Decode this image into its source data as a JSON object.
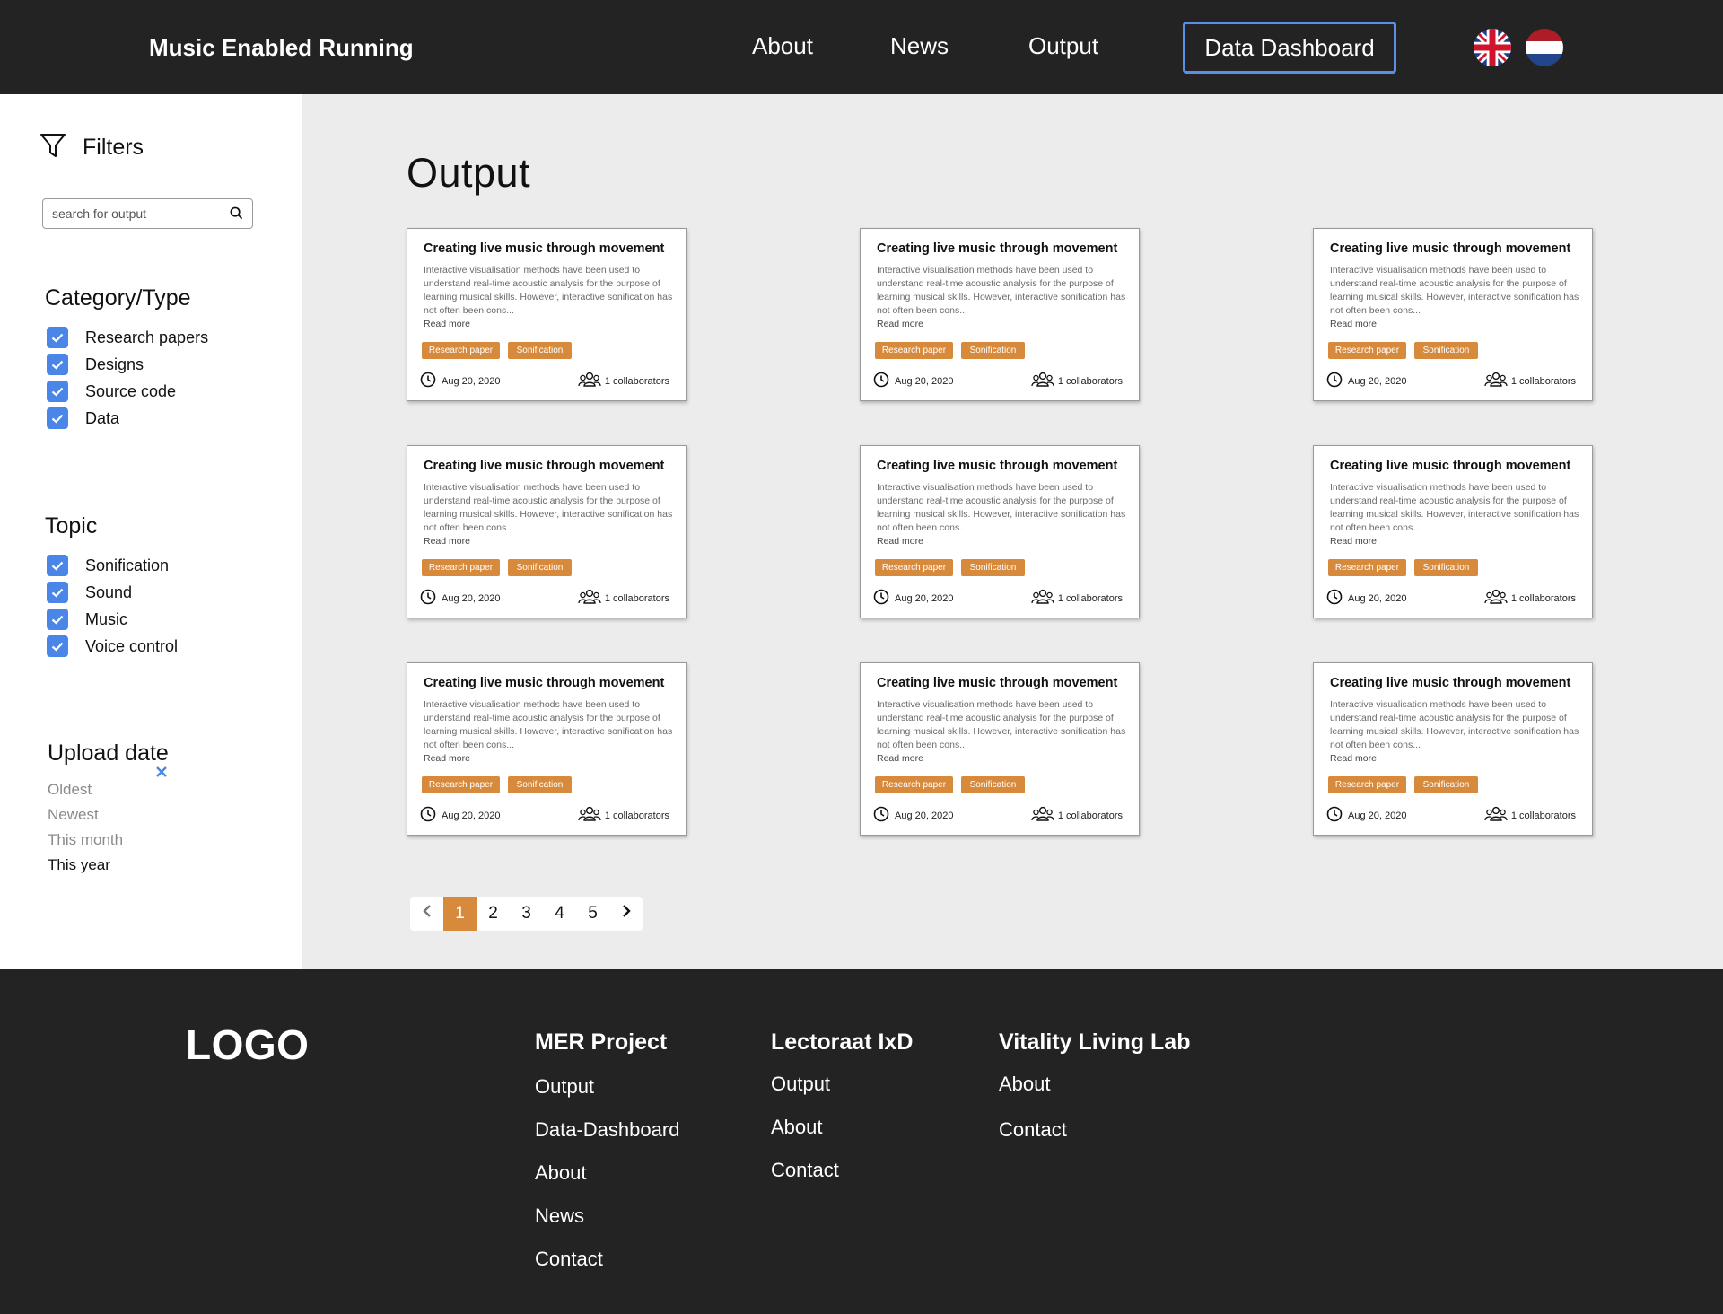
{
  "header": {
    "brand": "Music Enabled Running",
    "nav": {
      "about": "About",
      "news": "News",
      "output": "Output",
      "dashboard": "Data Dashboard"
    }
  },
  "sidebar": {
    "filters_title": "Filters",
    "search_placeholder": "search for output",
    "category": {
      "title": "Category/Type",
      "items": [
        {
          "label": "Research papers",
          "checked": true
        },
        {
          "label": "Designs",
          "checked": true
        },
        {
          "label": "Source code",
          "checked": true
        },
        {
          "label": "Data",
          "checked": true
        }
      ]
    },
    "topic": {
      "title": "Topic",
      "items": [
        {
          "label": "Sonification",
          "checked": true
        },
        {
          "label": "Sound",
          "checked": true
        },
        {
          "label": "Music",
          "checked": true
        },
        {
          "label": "Voice control",
          "checked": true
        }
      ]
    },
    "upload_date": {
      "title": "Upload date",
      "options": [
        {
          "label": "Oldest",
          "active": false
        },
        {
          "label": "Newest",
          "active": false
        },
        {
          "label": "This month",
          "active": false
        },
        {
          "label": "This year",
          "active": true
        }
      ]
    }
  },
  "main": {
    "title": "Output",
    "cards": [
      {
        "title": "Creating live music through movement",
        "description": "Interactive visualisation methods have been used to understand real-time acoustic analysis for the purpose of learning musical skills. However, interactive sonification has not often been cons...",
        "read_more": "Read more",
        "tags": [
          "Research paper",
          "Sonification"
        ],
        "date": "Aug 20, 2020",
        "collaborators": "1 collaborators"
      },
      {
        "title": "Creating live music through movement",
        "description": "Interactive visualisation methods have been used to understand real-time acoustic analysis for the purpose of learning musical skills. However, interactive sonification has not often been cons...",
        "read_more": "Read more",
        "tags": [
          "Research paper",
          "Sonification"
        ],
        "date": "Aug 20, 2020",
        "collaborators": "1 collaborators"
      },
      {
        "title": "Creating live music through movement",
        "description": "Interactive visualisation methods have been used to understand real-time acoustic analysis for the purpose of learning musical skills. However, interactive sonification has not often been cons...",
        "read_more": "Read more",
        "tags": [
          "Research paper",
          "Sonification"
        ],
        "date": "Aug 20, 2020",
        "collaborators": "1 collaborators"
      },
      {
        "title": "Creating live music through movement",
        "description": "Interactive visualisation methods have been used to understand real-time acoustic analysis for the purpose of learning musical skills. However, interactive sonification has not often been cons...",
        "read_more": "Read more",
        "tags": [
          "Research paper",
          "Sonification"
        ],
        "date": "Aug 20, 2020",
        "collaborators": "1 collaborators"
      },
      {
        "title": "Creating live music through movement",
        "description": "Interactive visualisation methods have been used to understand real-time acoustic analysis for the purpose of learning musical skills. However, interactive sonification has not often been cons...",
        "read_more": "Read more",
        "tags": [
          "Research paper",
          "Sonification"
        ],
        "date": "Aug 20, 2020",
        "collaborators": "1 collaborators"
      },
      {
        "title": "Creating live music through movement",
        "description": "Interactive visualisation methods have been used to understand real-time acoustic analysis for the purpose of learning musical skills. However, interactive sonification has not often been cons...",
        "read_more": "Read more",
        "tags": [
          "Research paper",
          "Sonification"
        ],
        "date": "Aug 20, 2020",
        "collaborators": "1 collaborators"
      },
      {
        "title": "Creating live music through movement",
        "description": "Interactive visualisation methods have been used to understand real-time acoustic analysis for the purpose of learning musical skills. However, interactive sonification has not often been cons...",
        "read_more": "Read more",
        "tags": [
          "Research paper",
          "Sonification"
        ],
        "date": "Aug 20, 2020",
        "collaborators": "1 collaborators"
      },
      {
        "title": "Creating live music through movement",
        "description": "Interactive visualisation methods have been used to understand real-time acoustic analysis for the purpose of learning musical skills. However, interactive sonification has not often been cons...",
        "read_more": "Read more",
        "tags": [
          "Research paper",
          "Sonification"
        ],
        "date": "Aug 20, 2020",
        "collaborators": "1 collaborators"
      },
      {
        "title": "Creating live music through movement",
        "description": "Interactive visualisation methods have been used to understand real-time acoustic analysis for the purpose of learning musical skills. However, interactive sonification has not often been cons...",
        "read_more": "Read more",
        "tags": [
          "Research paper",
          "Sonification"
        ],
        "date": "Aug 20, 2020",
        "collaborators": "1 collaborators"
      }
    ],
    "pagination": {
      "pages": [
        "1",
        "2",
        "3",
        "4",
        "5"
      ],
      "current": 1
    }
  },
  "footer": {
    "logo": "LOGO",
    "columns": [
      {
        "title": "MER Project",
        "links": [
          "Output",
          "Data-Dashboard",
          "About",
          "News",
          "Contact"
        ]
      },
      {
        "title": "Lectoraat IxD",
        "links": [
          "Output",
          "About",
          "Contact"
        ]
      },
      {
        "title": "Vitality Living Lab",
        "links": [
          "About",
          "Contact"
        ]
      }
    ]
  },
  "colors": {
    "dark": "#232323",
    "accent_orange": "#d88a3c",
    "accent_blue": "#4a86e8",
    "page_bg": "#ececec"
  },
  "icons": {
    "filter": "filter-icon",
    "search": "search-icon",
    "checkbox": "check-icon",
    "clear": "close-icon",
    "clock": "clock-icon",
    "people": "people-icon",
    "prev": "chevron-left-icon",
    "next": "chevron-right-icon"
  }
}
